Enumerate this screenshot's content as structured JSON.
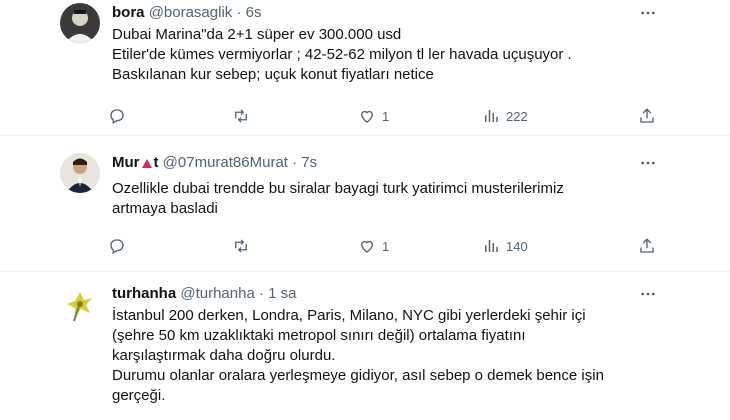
{
  "tweets": [
    {
      "name": "bora",
      "handle": "@borasaglik",
      "separator": "·",
      "time": "6s",
      "lines": [
        "Dubai Marina\"da 2+1 süper ev 300.000 usd",
        "Etiler'de kümes vermiyorlar ; 42-52-62 milyon tl ler havada uçuşuyor .",
        "Baskılanan kur sebep; uçuk konut fiyatları netice"
      ],
      "likes": "1",
      "views": "222"
    },
    {
      "name_prefix": "Mur",
      "name_suffix": "t",
      "handle": "@07murat86Murat",
      "separator": "·",
      "time": "7s",
      "lines": [
        "Ozellikle dubai  trendde bu siralar bayagi turk yatirimci musterilerimiz",
        "artmaya basladi"
      ],
      "likes": "1",
      "views": "140"
    },
    {
      "name": "turhanha",
      "handle": "@turhanha",
      "separator": "·",
      "time": "1 sa",
      "lines": [
        "İstanbul 200 derken, Londra, Paris, Milano, NYC gibi yerlerdeki şehir içi",
        "(şehre 50 km uzaklıktaki metropol sınırı değil)  ortalama fiyatını",
        "karşılaştırmak daha doğru olurdu.",
        "Durumu olanlar oralara yerleşmeye gidiyor, asıl sebep o demek bence işin",
        "gerçeği."
      ]
    }
  ],
  "colors": {
    "text": "#0f1419",
    "muted": "#536471",
    "divider": "#eff3f4",
    "flag": "#e0245e"
  },
  "icons": [
    "reply-icon",
    "retweet-icon",
    "like-icon",
    "views-icon",
    "share-icon",
    "more-icon"
  ]
}
